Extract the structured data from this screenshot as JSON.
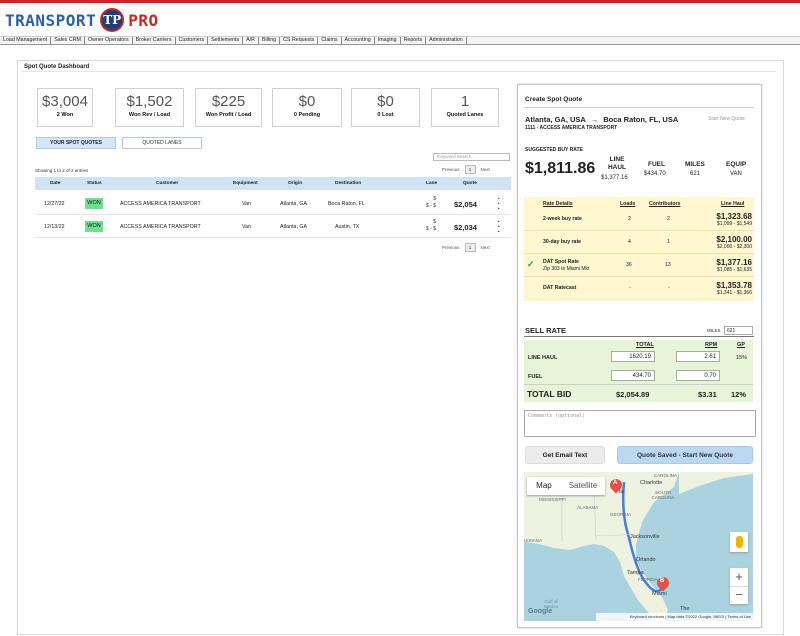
{
  "brand": {
    "left": "TRANSPORT",
    "badge": "TP",
    "right": "PRO"
  },
  "nav": [
    "Load Management",
    "Sales CRM",
    "Owner Operators",
    "Broker Carriers",
    "Customers",
    "Settlements",
    "A/R",
    "Billing",
    "CS Requests",
    "Claims",
    "Accounting",
    "Imaging",
    "Reports",
    "Administration"
  ],
  "page_title": "Spot Quote Dashboard",
  "stats": [
    {
      "value": "$3,004",
      "label": "2 Won"
    },
    {
      "value": "$1,502",
      "label": "Won Rev / Load"
    },
    {
      "value": "$225",
      "label": "Won Profit / Load"
    },
    {
      "value": "$0",
      "label": "0 Pending"
    },
    {
      "value": "$0",
      "label": "0 Lost"
    },
    {
      "value": "1",
      "label": "Quoted Lanes"
    }
  ],
  "tabs": {
    "spot": "YOUR SPOT QUOTES",
    "lanes": "QUOTED LANES"
  },
  "keyword_placeholder": "Keyword search",
  "showing": "Showing 1 to 2 of 2 entries",
  "pager": {
    "prev": "Previous",
    "page": "1",
    "next": "Next"
  },
  "table": {
    "headers": {
      "date": "Date",
      "status": "Status",
      "customer": "Customer",
      "equipment": "Equipment",
      "origin": "Origin",
      "destination": "Destination",
      "lane": "Lane",
      "quote": "Quote"
    },
    "rows": [
      {
        "date": "12/27/22",
        "status": "WON",
        "customer": "ACCESS AMERICA TRANSPORT",
        "equipment": "Van",
        "origin": "Atlanta, GA",
        "destination": "Boca Raton, FL",
        "lane_top": "$",
        "lane_bottom": "$ - $",
        "quote": "$2,054"
      },
      {
        "date": "12/13/22",
        "status": "WON",
        "customer": "ACCESS AMERICA TRANSPORT",
        "equipment": "Van",
        "origin": "Atlanta, GA",
        "destination": "Austin, TX",
        "lane_top": "$",
        "lane_bottom": "$ - $",
        "quote": "$2,034"
      }
    ]
  },
  "create": {
    "title": "Create Spot Quote",
    "from": "Atlanta, GA, USA",
    "arrow": "→",
    "to": "Boca Raton, FL, USA",
    "new_quote": "Start New Quote",
    "customer": "1111 - ACCESS AMERICA TRANSPORT",
    "suggested_label": "SUGGESTED BUY RATE",
    "suggested_value": "$1,811.86",
    "line_haul_label": "LINE HAUL",
    "line_haul_value": "$1,377.16",
    "fuel_label": "FUEL",
    "fuel_value": "$434.70",
    "miles_label": "MILES",
    "miles_value": "621",
    "equip_label": "EQUIP",
    "equip_value": "VAN"
  },
  "rates": {
    "headers": {
      "details": "Rate Details",
      "loads": "Loads",
      "contributors": "Contributors",
      "line_haul": "Line Haul"
    },
    "rows": [
      {
        "name": "2-week buy rate",
        "sub": "",
        "loads": "2",
        "contributors": "2",
        "value": "$1,323.68",
        "range": "$1,099 - $1,549",
        "check": ""
      },
      {
        "name": "30-day buy rate",
        "sub": "",
        "loads": "4",
        "contributors": "1",
        "value": "$2,100.00",
        "range": "$2,000 - $2,300",
        "check": ""
      },
      {
        "name": "DAT Spot Rate",
        "sub": "Zip 303 to Miami Mkt",
        "loads": "36",
        "contributors": "13",
        "value": "$1,377.16",
        "range": "$1,085 - $1,635",
        "check": "✓"
      },
      {
        "name": "DAT Ratecast",
        "sub": "",
        "loads": "-",
        "contributors": "-",
        "value": "$1,353.78",
        "range": "$1,341 - $1,366",
        "check": ""
      }
    ]
  },
  "sell": {
    "title": "SELL RATE",
    "miles_label": "MILES",
    "miles_value": "621",
    "total_h": "TOTAL",
    "rpm_h": "RPM",
    "gp_h": "GP",
    "line_haul_label": "LINE HAUL",
    "line_haul_total": "1620.19",
    "line_haul_rpm": "2.61",
    "line_haul_gp": "15%",
    "fuel_label": "FUEL",
    "fuel_total": "434.70",
    "fuel_rpm": "0.70",
    "bid_label": "TOTAL BID",
    "bid_total": "$2,054.89",
    "bid_rpm": "$3.31",
    "bid_gp": "12%"
  },
  "comments_placeholder": "Comments (optional)",
  "buttons": {
    "email": "Get Email Text",
    "saved": "Quote Saved  -  Start New Quote"
  },
  "map": {
    "tab_map": "Map",
    "tab_sat": "Satellite",
    "labels": {
      "mississippi": "MISSISSIPPI",
      "alabama": "ALABAMA",
      "georgia": "GEORGIA",
      "charlotte": "Charlotte",
      "carolina": "CAROLINA",
      "south_carolina": "SOUTH CAROLINA",
      "louisiana": "UISIANA",
      "jacksonville": "Jacksonville",
      "orlando": "Orlando",
      "tampa": "Tampa",
      "florida": "FLORIDA",
      "miami": "Miami",
      "gulf": "Gulf of Mexico",
      "the": "The",
      "atlanta": "ta"
    },
    "marker_a": "A",
    "marker_b": "B",
    "footer": "Keyboard shortcuts  |  Map data ©2022 Google, INEGI  |  Terms of Use",
    "google": "Google",
    "colors": {
      "water": "#aad3df",
      "land": "#e9efd9",
      "route": "#4a7fd6",
      "marker": "#e0524a"
    }
  }
}
